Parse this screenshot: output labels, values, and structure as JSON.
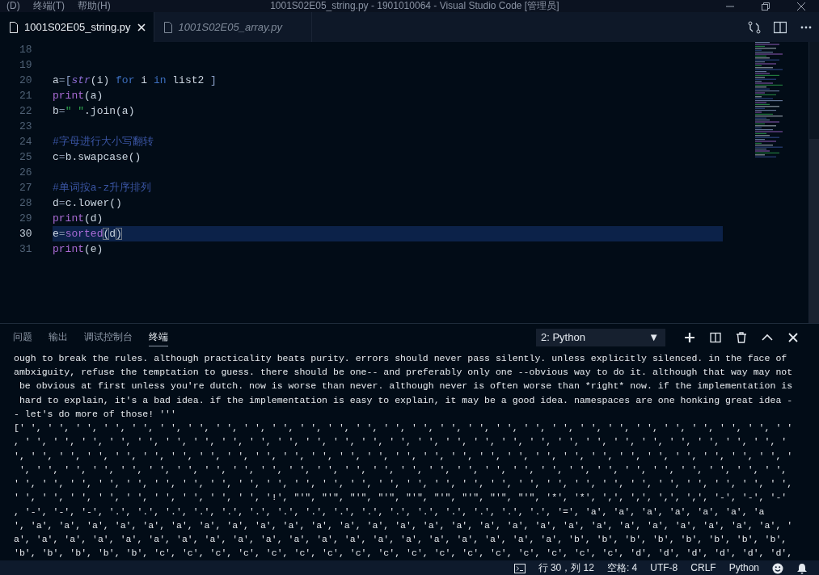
{
  "menu": [
    "(D)",
    "终端(T)",
    "帮助(H)"
  ],
  "window": {
    "title": "1001S02E05_string.py - 1901010064 - Visual Studio Code [管理员]"
  },
  "tabs": [
    {
      "label": "1001S02E05_string.py",
      "selected": true,
      "preview": false
    },
    {
      "label": "1001S02E05_array.py",
      "selected": false,
      "preview": true
    }
  ],
  "editor": {
    "lines": [
      {
        "number": "18",
        "current": false
      },
      {
        "number": "19",
        "current": false
      },
      {
        "number": "20",
        "current": false,
        "tokens": [
          {
            "kind": "plain",
            "text": "a"
          },
          {
            "kind": "op",
            "text": "="
          },
          {
            "kind": "bracket",
            "text": "["
          },
          {
            "kind": "builtin",
            "text": "str"
          },
          {
            "kind": "plain",
            "text": "(i) "
          },
          {
            "kind": "keyword",
            "text": "for"
          },
          {
            "kind": "plain",
            "text": " i "
          },
          {
            "kind": "keyword",
            "text": "in"
          },
          {
            "kind": "plain",
            "text": " list2 "
          },
          {
            "kind": "bracket",
            "text": "]"
          }
        ]
      },
      {
        "number": "21",
        "current": false,
        "tokens": [
          {
            "kind": "function",
            "text": "print"
          },
          {
            "kind": "plain",
            "text": "(a)"
          }
        ]
      },
      {
        "number": "22",
        "current": false,
        "tokens": [
          {
            "kind": "plain",
            "text": "b"
          },
          {
            "kind": "op",
            "text": "="
          },
          {
            "kind": "string",
            "text": "\" \""
          },
          {
            "kind": "plain",
            "text": ".join(a)"
          }
        ]
      },
      {
        "number": "23",
        "current": false
      },
      {
        "number": "24",
        "current": false,
        "tokens": [
          {
            "kind": "comment",
            "text": "#字母进行大小写翻转"
          }
        ]
      },
      {
        "number": "25",
        "current": false,
        "tokens": [
          {
            "kind": "plain",
            "text": "c"
          },
          {
            "kind": "op",
            "text": "="
          },
          {
            "kind": "plain",
            "text": "b.swapcase()"
          }
        ]
      },
      {
        "number": "26",
        "current": false
      },
      {
        "number": "27",
        "current": false,
        "tokens": [
          {
            "kind": "comment",
            "text": "#单词按a-z升序排列"
          }
        ]
      },
      {
        "number": "28",
        "current": false,
        "tokens": [
          {
            "kind": "plain",
            "text": "d"
          },
          {
            "kind": "op",
            "text": "="
          },
          {
            "kind": "plain",
            "text": "c.lower()"
          }
        ]
      },
      {
        "number": "29",
        "current": false,
        "tokens": [
          {
            "kind": "function",
            "text": "print"
          },
          {
            "kind": "plain",
            "text": "(d)"
          }
        ]
      },
      {
        "number": "30",
        "current": true,
        "tokens": [
          {
            "kind": "plain",
            "text": "e"
          },
          {
            "kind": "op",
            "text": "="
          },
          {
            "kind": "function",
            "text": "sorted"
          },
          {
            "kind": "match",
            "text": "("
          },
          {
            "kind": "plain",
            "text": "d"
          },
          {
            "kind": "match",
            "text": ")"
          }
        ]
      },
      {
        "number": "31",
        "current": false,
        "tokens": [
          {
            "kind": "function",
            "text": "print"
          },
          {
            "kind": "plain",
            "text": "(e)"
          }
        ]
      }
    ]
  },
  "panel": {
    "tabs": [
      {
        "label": "问题",
        "selected": false
      },
      {
        "label": "输出",
        "selected": false
      },
      {
        "label": "调试控制台",
        "selected": false
      },
      {
        "label": "终端",
        "selected": true
      }
    ],
    "terminal_select": {
      "value": "2: Python",
      "caret": "▼"
    },
    "terminal_lines": [
      "ough to break the rules. although practicality beats purity. errors should never pass silently. unless explicitly silenced. in the face of",
      "ambxiguity, refuse the temptation to guess. there should be one-- and preferably only one --obvious way to do it. although that way may not",
      " be obvious at first unless you're dutch. now is worse than never. although never is often worse than *right* now. if the implementation is",
      " hard to explain, it's a bad idea. if the implementation is easy to explain, it may be a good idea. namespaces are one honking great idea -",
      "- let's do more of those! '''",
      "[' ', ' ', ' ', ' ', ' ', ' ', ' ', ' ', ' ', ' ', ' ', ' ', ' ', ' ', ' ', ' ', ' ', ' ', ' ', ' ', ' ', ' ', ' ', ' ', ' ', ' ', ' ', ' '",
      ", ' ', ' ', ' ', ' ', ' ', ' ', ' ', ' ', ' ', ' ', ' ', ' ', ' ', ' ', ' ', ' ', ' ', ' ', ' ', ' ', ' ', ' ', ' ', ' ', ' ', ' ', ' ', ' ",
      "', ' ', ' ', ' ', ' ', ' ', ' ', ' ', ' ', ' ', ' ', ' ', ' ', ' ', ' ', ' ', ' ', ' ', ' ', ' ', ' ', ' ', ' ', ' ', ' ', ' ', ' ', ' ', '",
      " ', ' ', ' ', ' ', ' ', ' ', ' ', ' ', ' ', ' ', ' ', ' ', ' ', ' ', ' ', ' ', ' ', ' ', ' ', ' ', ' ', ' ', ' ', ' ', ' ', ' ', ' ', ' ',",
      "' ', ' ', ' ', ' ', ' ', ' ', ' ', ' ', ' ', ' ', ' ', ' ', ' ', ' ', ' ', ' ', ' ', ' ', ' ', ' ', ' ', ' ', ' ', ' ', ' ', ' ', ' ', ' ',",
      "' ', ' ', ' ', ' ', ' ', ' ', ' ', ' ', ' ', '!', \"'\", \"'\", \"'\", \"'\", \"'\", \"'\", \"'\", \"'\", \"'\", '*', '*', ',', ',', ',', ',', '-', '-', '-'",
      ", '-', '-', '-', '.', '.', '.', '.', '.', '.', '.', '.', '.', '.', '.', '.', '.', '.', '.', '.', '=', 'a', 'a', 'a', 'a', 'a', 'a', 'a",
      "', 'a', 'a', 'a', 'a', 'a', 'a', 'a', 'a', 'a', 'a', 'a', 'a', 'a', 'a', 'a', 'a', 'a', 'a', 'a', 'a', 'a', 'a', 'a', 'a', 'a', 'a', 'a', '",
      "a', 'a', 'a', 'a', 'a', 'a', 'a', 'a', 'a', 'a', 'a', 'a', 'a', 'a', 'a', 'a', 'a', 'a', 'a', 'a', 'b', 'b', 'b', 'b', 'b', 'b', 'b', 'b',",
      "'b', 'b', 'b', 'b', 'b', 'c', 'c', 'c', 'c', 'c', 'c', 'c', 'c', 'c', 'c', 'c', 'c', 'c', 'c', 'c', 'c', 'c', 'd', 'd', 'd', 'd', 'd', 'd',"
    ]
  },
  "status_bar": {
    "position": "行 30，列 12",
    "indent": "空格: 4",
    "encoding": "UTF-8",
    "eol": "CRLF",
    "language": "Python"
  }
}
